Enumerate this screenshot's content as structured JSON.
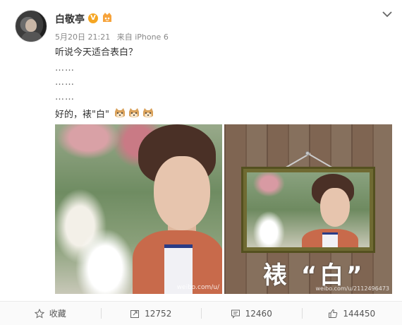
{
  "post": {
    "username": "白敬亭",
    "verified_mark": "V",
    "time": "5月20日 21:21",
    "source": "来自 iPhone 6",
    "lines": [
      "听说今天适合表白？",
      "……",
      "……",
      "……"
    ],
    "last_line": "好的，裱\"白\"",
    "image2_caption": "裱 “白”",
    "watermark1": "weibo.com/u/",
    "watermark2": "weibo.com/u/2112496473"
  },
  "actions": {
    "favorite": "收藏",
    "repost": "12752",
    "comment": "12460",
    "like": "144450"
  },
  "colors": {
    "verified": "#f5a623",
    "text": "#333333",
    "meta": "#888888",
    "action_text": "#555555"
  }
}
